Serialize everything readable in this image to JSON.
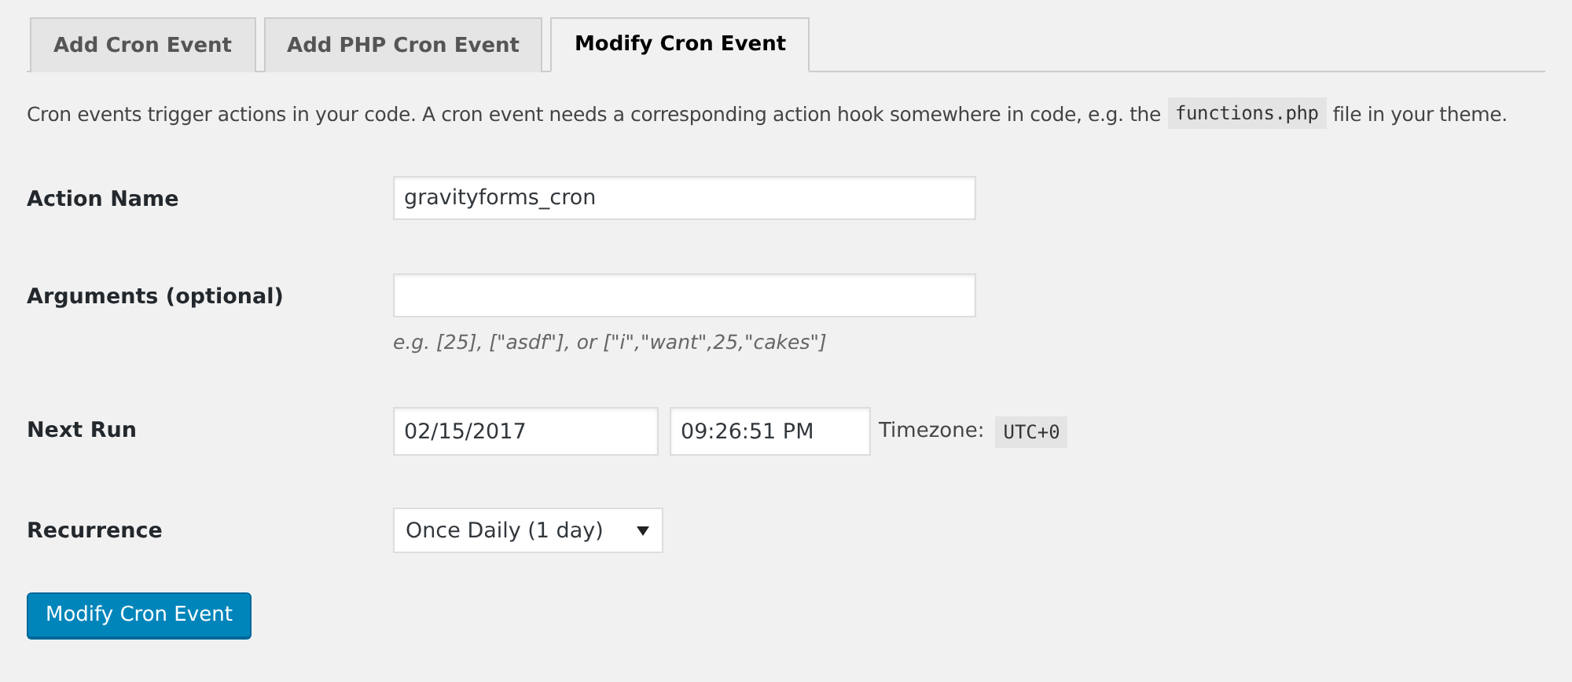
{
  "tabs": [
    {
      "label": "Add Cron Event",
      "selected": false
    },
    {
      "label": "Add PHP Cron Event",
      "selected": false
    },
    {
      "label": "Modify Cron Event",
      "selected": true
    }
  ],
  "description": {
    "before": "Cron events trigger actions in your code. A cron event needs a corresponding action hook somewhere in code, e.g. the",
    "code": "functions.php",
    "after": "file in your theme."
  },
  "fields": [
    {
      "kind": "text",
      "label": "Action Name",
      "value": "gravityforms_cron"
    },
    {
      "kind": "text",
      "label": "Arguments (optional)",
      "hint": "e.g. [25], [\"asdf\"], or [\"i\",\"want\",25,\"cakes\"]"
    },
    {
      "kind": "datetime",
      "label": "Next Run",
      "date": "02/15/2017",
      "time": "09:26:51 PM",
      "timezone_label": "Timezone:",
      "timezone": "UTC+0"
    },
    {
      "kind": "select",
      "label": "Recurrence",
      "value": "Once Daily (1 day)"
    }
  ],
  "submit": "Modify Cron Event"
}
